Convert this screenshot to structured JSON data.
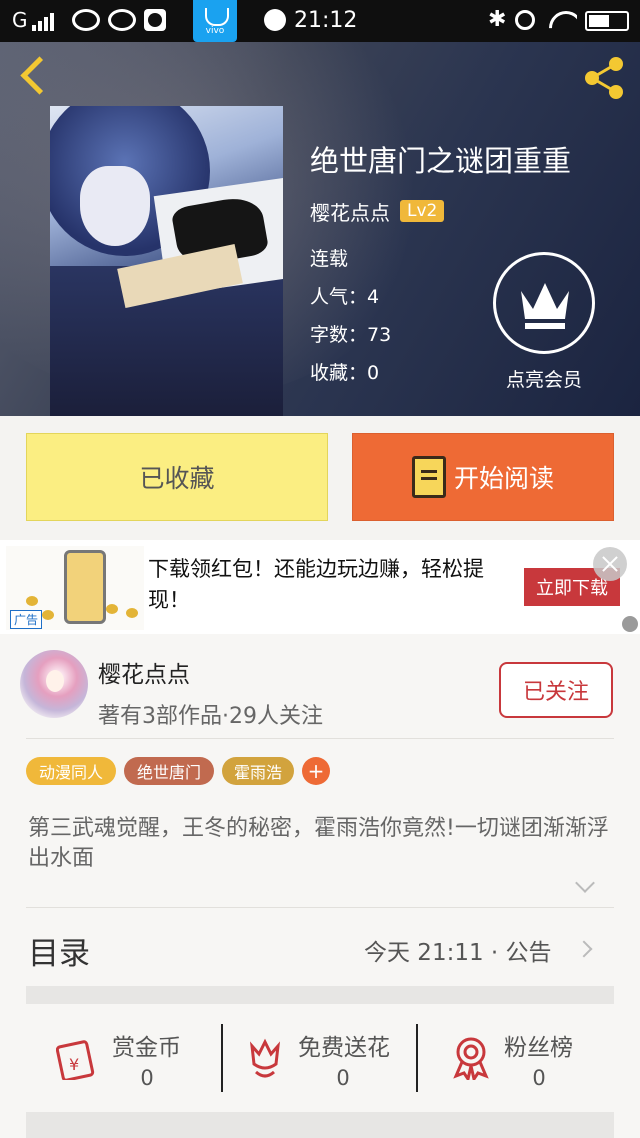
{
  "status_bar": {
    "carrier": "G",
    "time": "21:12",
    "vivo_label": "vivo"
  },
  "book": {
    "title": "绝世唐门之谜团重重",
    "author": "樱花点点",
    "level": "Lv2",
    "status": "连载",
    "popularity": "人气：4",
    "word_count": "字数：73",
    "favorites": "收藏：0",
    "vip_label": "点亮会员"
  },
  "actions": {
    "collect_label": "已收藏",
    "read_label": "开始阅读"
  },
  "ad": {
    "text": "下载领红包！还能边玩边赚，轻松提现！",
    "cta": "立即下载",
    "badge": "广告"
  },
  "author_card": {
    "name": "樱花点点",
    "stats": "著有3部作品·29人关注",
    "follow_label": "已关注"
  },
  "tags": [
    {
      "label": "动漫同人",
      "color": "#f0b83a"
    },
    {
      "label": "绝世唐门",
      "color": "#c16a4f"
    },
    {
      "label": "霍雨浩",
      "color": "#d2a33d"
    }
  ],
  "tag_add": "+",
  "description": "第三武魂觉醒，王冬的秘密，霍雨浩你竟然!一切谜团渐渐浮出水面",
  "toc": {
    "title": "目录",
    "meta": "今天 21:11 · 公告"
  },
  "features": [
    {
      "label": "赏金币",
      "count": "0",
      "icon": "red-envelope-icon"
    },
    {
      "label": "免费送花",
      "count": "0",
      "icon": "flower-icon"
    },
    {
      "label": "粉丝榜",
      "count": "0",
      "icon": "medal-icon"
    }
  ],
  "colors": {
    "accent_orange": "#ee6a35",
    "collect_yellow": "#fbee82",
    "red": "#c8383c",
    "gold": "#f3c832"
  }
}
